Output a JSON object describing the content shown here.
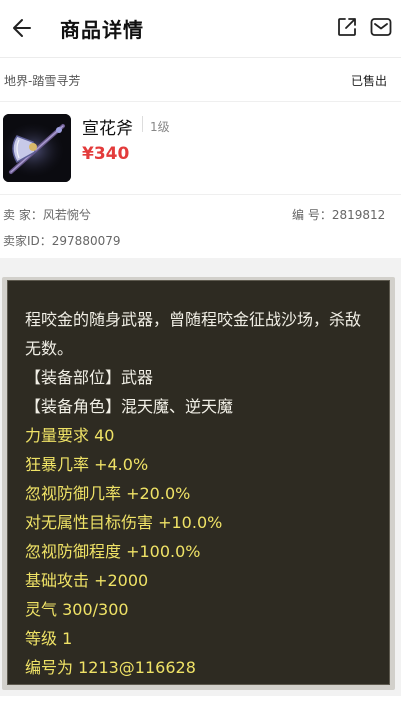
{
  "header": {
    "title": "商品详情"
  },
  "listing": {
    "server": "地界-踏雪寻芳",
    "status": "已售出",
    "item_name": "宣花斧",
    "item_level": "1级",
    "price": "¥340",
    "seller_label": "卖 家：",
    "seller_name": "风若惋兮",
    "number_label": "编 号：",
    "number": "2819812",
    "seller_id_label": "卖家ID：",
    "seller_id": "297880079"
  },
  "description": {
    "text": "程咬金的随身武器，曾随程咬金征战沙场，杀敌无数。",
    "attributes": [
      {
        "text": "【装备部位】武器",
        "color": "white"
      },
      {
        "text": "【装备角色】混天魔、逆天魔",
        "color": "white"
      },
      {
        "text": "力量要求 40",
        "color": "yellow"
      },
      {
        "text": "狂暴几率 +4.0%",
        "color": "yellow"
      },
      {
        "text": "忽视防御几率 +20.0%",
        "color": "yellow"
      },
      {
        "text": "对无属性目标伤害 +10.0%",
        "color": "yellow"
      },
      {
        "text": "忽视防御程度 +100.0%",
        "color": "yellow"
      },
      {
        "text": "基础攻击 +2000",
        "color": "yellow"
      },
      {
        "text": "灵气 300/300",
        "color": "yellow"
      },
      {
        "text": "等级 1",
        "color": "yellow"
      },
      {
        "text": "编号为 1213@116628",
        "color": "yellow"
      }
    ]
  },
  "icons": {
    "back": "back-arrow-icon",
    "share": "share-icon",
    "mail": "mail-icon"
  },
  "colors": {
    "price": "#e33b3b",
    "panel_bg": "#2e2b22",
    "attr_yellow": "#efe266"
  }
}
